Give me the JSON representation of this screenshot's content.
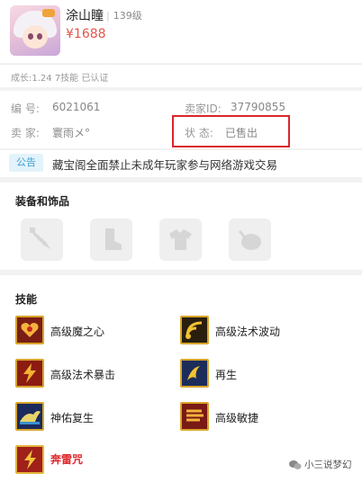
{
  "header": {
    "name": "涂山瞳",
    "separator": "|",
    "level": "139级",
    "price": "¥1688"
  },
  "growth": "成长:1.24 7技能 已认证",
  "info": {
    "serial_label": "编  号:",
    "serial_value": "6021061",
    "seller_id_label": "卖家ID:",
    "seller_id_value": "37790855",
    "seller_label": "卖  家:",
    "seller_value": "寰雨メ°",
    "status_label": "状  态:",
    "status_value": "已售出"
  },
  "notice": {
    "tag": "公告",
    "text": "藏宝阁全面禁止未成年玩家参与网络游戏交易"
  },
  "equipment": {
    "title": "装备和饰品",
    "slots": [
      {
        "icon": "weapon-slot-icon"
      },
      {
        "icon": "boots-slot-icon"
      },
      {
        "icon": "armor-slot-icon"
      },
      {
        "icon": "accessory-slot-icon"
      }
    ]
  },
  "skills": {
    "title": "技能",
    "items": [
      {
        "label": "高级魔之心",
        "icon": "magic-heart-icon"
      },
      {
        "label": "高级法术波动",
        "icon": "spell-wave-icon"
      },
      {
        "label": "高级法术暴击",
        "icon": "spell-crit-icon"
      },
      {
        "label": "再生",
        "icon": "regen-icon"
      },
      {
        "label": "神佑复生",
        "icon": "divine-revive-icon"
      },
      {
        "label": "高级敏捷",
        "icon": "agility-icon"
      },
      {
        "label": "奔雷咒",
        "icon": "thunder-icon"
      }
    ]
  },
  "watermark": "小三说梦幻",
  "colors": {
    "price": "#e4554b",
    "highlight_box": "#d9262a",
    "tag_bg": "#e3f3fb",
    "tag_text": "#3aa0d4",
    "skill_border": "#d8a52a",
    "special_skill": "#e0262d"
  }
}
